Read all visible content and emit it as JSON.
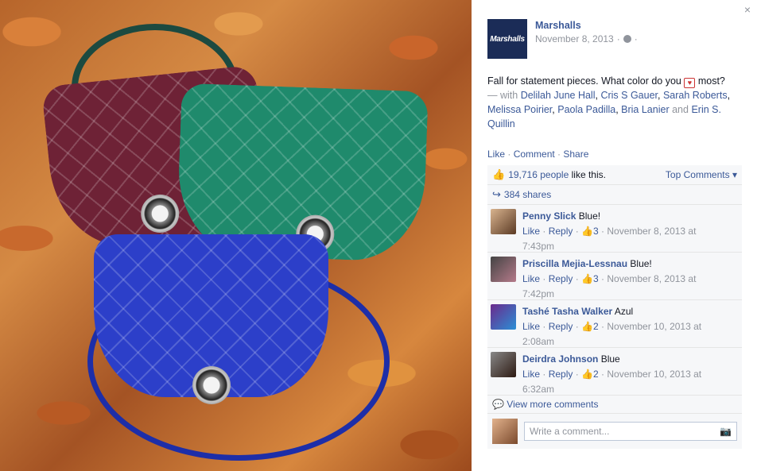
{
  "close_label": "×",
  "post": {
    "page_name": "Marshalls",
    "avatar_text": "Marshalls",
    "date": "November 8, 2013",
    "text_before": "Fall for statement pieces. What color do you",
    "text_after": "most?",
    "with_prefix": "— with",
    "tagged": [
      "Delilah June Hall",
      "Cris S Gauer",
      "Sarah Roberts",
      "Melissa Poirier",
      "Paola Padilla",
      "Bria Lanier",
      "Erin S. Quillin"
    ],
    "and_word": "and"
  },
  "actions": {
    "like": "Like",
    "comment": "Comment",
    "share": "Share"
  },
  "stats": {
    "likes_count": "19,716 people",
    "likes_suffix": "like this.",
    "top_comments": "Top Comments",
    "shares": "384 shares"
  },
  "comments": [
    {
      "name": "Penny Slick",
      "text": "Blue!",
      "likes": "3",
      "time_a": "November 8, 2013 at",
      "time_b": "7:43pm"
    },
    {
      "name": "Priscilla Mejia-Lessnau",
      "text": "Blue!",
      "likes": "3",
      "time_a": "November 8, 2013 at",
      "time_b": "7:42pm"
    },
    {
      "name": "Tashé Tasha Walker",
      "text": "Azul",
      "likes": "2",
      "time_a": "November 10, 2013 at",
      "time_b": "2:08am"
    },
    {
      "name": "Deirdra Johnson",
      "text": "Blue",
      "likes": "2",
      "time_a": "November 10, 2013 at",
      "time_b": "6:32am"
    }
  ],
  "comment_actions": {
    "like": "Like",
    "reply": "Reply"
  },
  "view_more": "View more comments",
  "write_placeholder": "Write a comment...",
  "colors": {
    "link": "#3b5998",
    "muted": "#90949c",
    "panel_bg": "#f6f7f9"
  }
}
